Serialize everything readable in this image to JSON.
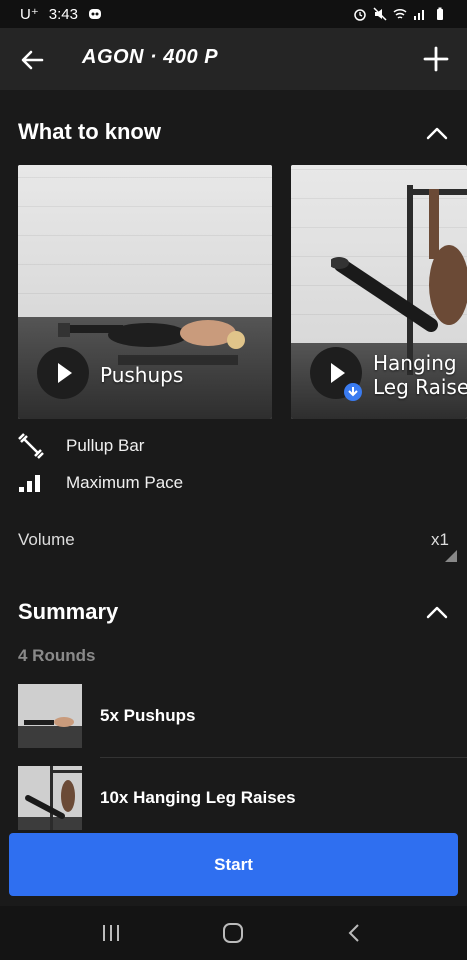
{
  "status_bar": {
    "time": "3:43",
    "carrier": "U⁺"
  },
  "app_bar": {
    "title": "AGON · 400 P"
  },
  "what_to_know": {
    "title": "What to know",
    "videos": [
      {
        "label": "Pushups"
      },
      {
        "label": "Hanging Leg Raises"
      }
    ],
    "equipment": "Pullup Bar",
    "pace": "Maximum Pace"
  },
  "volume": {
    "label": "Volume",
    "value": "x1"
  },
  "summary": {
    "title": "Summary",
    "rounds": "4 Rounds",
    "exercises": [
      {
        "name": "5x  Pushups"
      },
      {
        "name": "10x  Hanging Leg Raises"
      }
    ]
  },
  "actions": {
    "start_label": "Start"
  },
  "colors": {
    "accent": "#2f6ff0",
    "background": "#1a1a1a",
    "app_bar": "#252525"
  },
  "icons": [
    "back-arrow-icon",
    "plus-icon",
    "chevron-up-icon",
    "play-icon",
    "dumbbell-icon",
    "bars-icon",
    "download-icon"
  ]
}
